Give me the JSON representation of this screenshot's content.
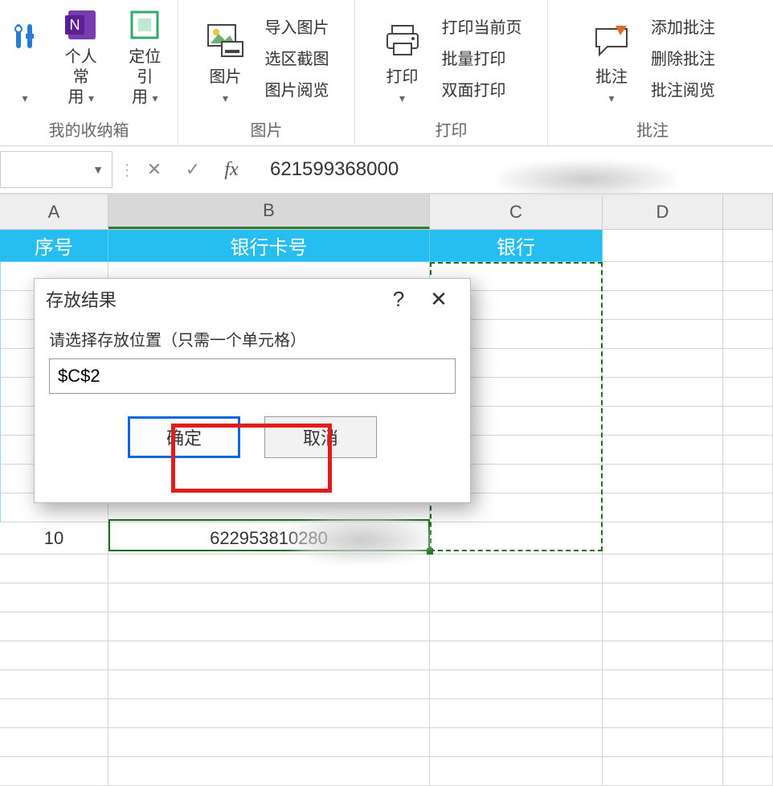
{
  "ribbon": {
    "groups": {
      "fav": {
        "title": "我的收纳箱",
        "tools_label": "",
        "personal_label": "个人常\n用",
        "locate_label": "定位引\n用"
      },
      "pic": {
        "title": "图片",
        "pic_label": "图片",
        "import_label": "导入图片",
        "crop_label": "选区截图",
        "view_label": "图片阅览"
      },
      "print": {
        "title": "打印",
        "print_label": "打印",
        "cur_label": "打印当前页",
        "batch_label": "批量打印",
        "duplex_label": "双面打印"
      },
      "annot": {
        "title": "批注",
        "annot_label": "批注",
        "add_label": "添加批注",
        "del_label": "删除批注",
        "view_label": "批注阅览"
      }
    }
  },
  "formula_bar": {
    "fx": "fx",
    "value": "621599368000"
  },
  "columns": {
    "A": "A",
    "B": "B",
    "C": "C",
    "D": "D"
  },
  "table": {
    "headers": {
      "a": "序号",
      "b": "银行卡号",
      "c": "银行"
    },
    "row11": {
      "a": "10",
      "b": "622953810280"
    }
  },
  "dialog": {
    "title": "存放结果",
    "help": "?",
    "close": "✕",
    "label": "请选择存放位置（只需一个单元格）",
    "value": "$C$2",
    "ok": "确定",
    "cancel": "取消"
  }
}
